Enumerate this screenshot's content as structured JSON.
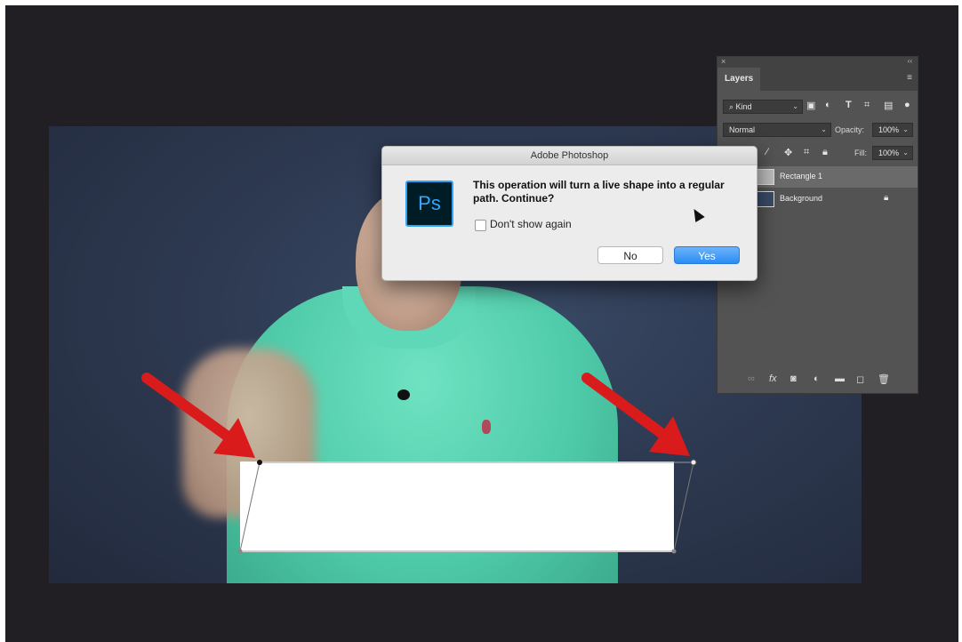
{
  "dialog": {
    "title": "Adobe Photoshop",
    "app_icon_text": "Ps",
    "message": "This operation will turn a live shape into a regular path. Continue?",
    "checkbox_label": "Don't show again",
    "checkbox_checked": false,
    "no_label": "No",
    "yes_label": "Yes"
  },
  "layers_panel": {
    "title": "Layers",
    "filter_kind": "Kind",
    "blend_mode": "Normal",
    "opacity_label": "Opacity:",
    "opacity_value": "100%",
    "fill_label": "Fill:",
    "fill_value": "100%",
    "layers": [
      {
        "name": "Rectangle 1",
        "selected": true,
        "icon": "shape-thumb-icon"
      },
      {
        "name": "Background",
        "selected": false,
        "icon": "image-thumb-icon",
        "locked": true
      }
    ],
    "footer_icons": [
      "link-icon",
      "fx-icon",
      "mask-icon",
      "adjustment-icon",
      "folder-icon",
      "new-layer-icon",
      "trash-icon"
    ]
  },
  "colors": {
    "workspace_bg": "#221f24",
    "arrow": "#d91b1b",
    "dialog_accent": "#2a8cf5",
    "ps_icon_blue": "#31a8ff"
  }
}
